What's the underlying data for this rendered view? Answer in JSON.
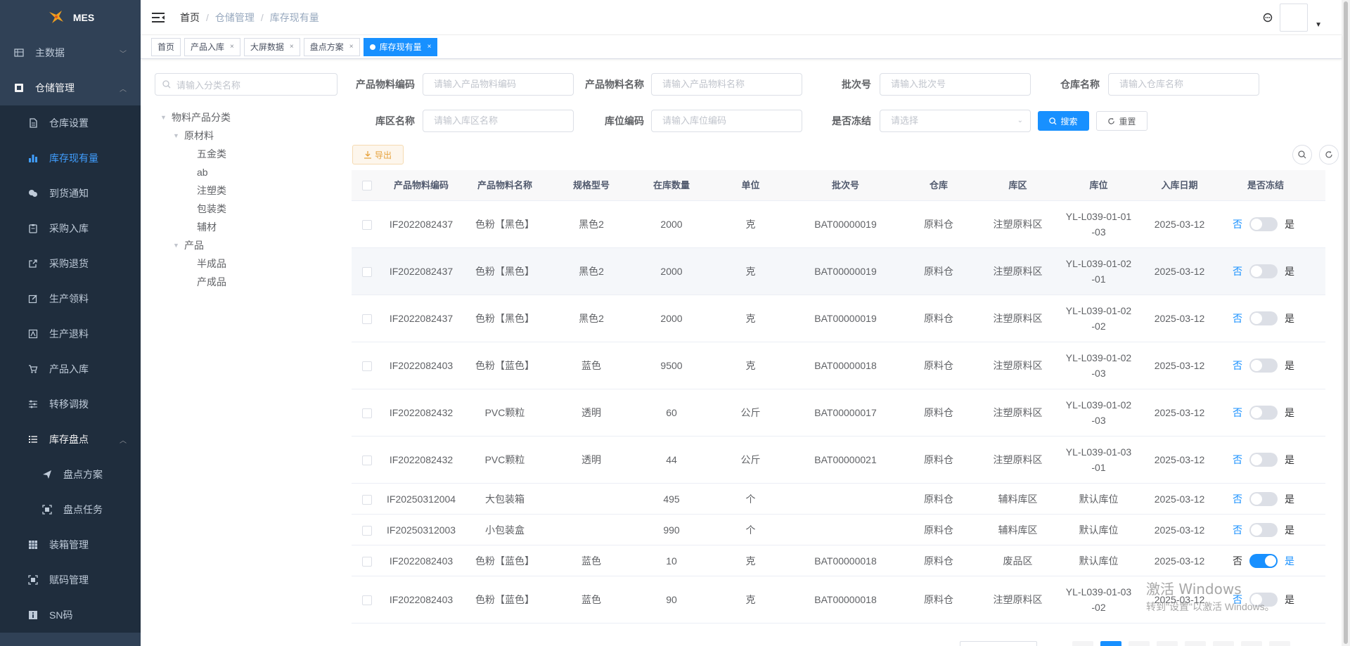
{
  "app": {
    "logo_text": "MES"
  },
  "sidebar": {
    "items": [
      {
        "label": "主数据",
        "icon": "table-icon",
        "level": 0,
        "chevron": "down"
      },
      {
        "label": "仓储管理",
        "icon": "warehouse-icon",
        "level": 0,
        "chevron": "up",
        "open": true
      },
      {
        "label": "仓库设置",
        "icon": "document-icon",
        "level": 1
      },
      {
        "label": "库存现有量",
        "icon": "bar-chart-icon",
        "level": 1,
        "active": true
      },
      {
        "label": "到货通知",
        "icon": "wechat-icon",
        "level": 1
      },
      {
        "label": "采购入库",
        "icon": "clipboard-icon",
        "level": 1
      },
      {
        "label": "采购退货",
        "icon": "external-link-icon",
        "level": 1
      },
      {
        "label": "生产领料",
        "icon": "edit-icon",
        "level": 1
      },
      {
        "label": "生产退料",
        "icon": "box-icon",
        "level": 1
      },
      {
        "label": "产品入库",
        "icon": "cart-icon",
        "level": 1
      },
      {
        "label": "转移调拨",
        "icon": "sliders-icon",
        "level": 1
      },
      {
        "label": "库存盘点",
        "icon": "list-icon",
        "level": 1,
        "chevron": "up",
        "open": true
      },
      {
        "label": "盘点方案",
        "icon": "send-icon",
        "level": 2
      },
      {
        "label": "盘点任务",
        "icon": "scan-icon",
        "level": 2
      },
      {
        "label": "装箱管理",
        "icon": "grid-icon",
        "level": 1
      },
      {
        "label": "赋码管理",
        "icon": "scan-icon",
        "level": 1
      },
      {
        "label": "SN码",
        "icon": "info-icon",
        "level": 1
      }
    ]
  },
  "navbar": {
    "breadcrumb": [
      "首页",
      "仓储管理",
      "库存现有量"
    ]
  },
  "tags": [
    {
      "label": "首页",
      "closable": false,
      "active": false
    },
    {
      "label": "产品入库",
      "closable": true,
      "active": false
    },
    {
      "label": "大屏数据",
      "closable": true,
      "active": false
    },
    {
      "label": "盘点方案",
      "closable": true,
      "active": false
    },
    {
      "label": "库存现有量",
      "closable": true,
      "active": true
    }
  ],
  "tree": {
    "search_placeholder": "请输入分类名称",
    "nodes": [
      {
        "label": "物料产品分类",
        "depth": 0,
        "arrow": true
      },
      {
        "label": "原材料",
        "depth": 1,
        "arrow": true
      },
      {
        "label": "五金类",
        "depth": 2,
        "arrow": false
      },
      {
        "label": "ab",
        "depth": 2,
        "arrow": false
      },
      {
        "label": "注塑类",
        "depth": 2,
        "arrow": false
      },
      {
        "label": "包装类",
        "depth": 2,
        "arrow": false
      },
      {
        "label": "辅材",
        "depth": 2,
        "arrow": false
      },
      {
        "label": "产品",
        "depth": 1,
        "arrow": true
      },
      {
        "label": "半成品",
        "depth": 2,
        "arrow": false
      },
      {
        "label": "产成品",
        "depth": 2,
        "arrow": false
      }
    ]
  },
  "filters": {
    "item_code": {
      "label": "产品物料编码",
      "placeholder": "请输入产品物料编码"
    },
    "item_name": {
      "label": "产品物料名称",
      "placeholder": "请输入产品物料名称"
    },
    "batch": {
      "label": "批次号",
      "placeholder": "请输入批次号"
    },
    "warehouse": {
      "label": "仓库名称",
      "placeholder": "请输入仓库名称"
    },
    "area": {
      "label": "库区名称",
      "placeholder": "请输入库区名称"
    },
    "location": {
      "label": "库位编码",
      "placeholder": "请输入库位编码"
    },
    "frozen": {
      "label": "是否冻结",
      "placeholder": "请选择"
    },
    "search_label": "搜索",
    "reset_label": "重置",
    "export_label": "导出"
  },
  "table": {
    "headers": [
      "产品物料编码",
      "产品物料名称",
      "规格型号",
      "在库数量",
      "单位",
      "批次号",
      "仓库",
      "库区",
      "库位",
      "入库日期",
      "是否冻结"
    ],
    "rows": [
      {
        "code": "IF2022082437",
        "name": "色粉【黑色】",
        "spec": "黑色2",
        "qty": "2000",
        "unit": "克",
        "batch": "BAT00000019",
        "wh": "原料仓",
        "area": "注塑原料区",
        "loc1": "YL-L039-01-01",
        "loc2": "-03",
        "date": "2025-03-12",
        "no": "否",
        "yes": "是",
        "frozen": false
      },
      {
        "code": "IF2022082437",
        "name": "色粉【黑色】",
        "spec": "黑色2",
        "qty": "2000",
        "unit": "克",
        "batch": "BAT00000019",
        "wh": "原料仓",
        "area": "注塑原料区",
        "loc1": "YL-L039-01-02",
        "loc2": "-01",
        "date": "2025-03-12",
        "no": "否",
        "yes": "是",
        "frozen": false,
        "highlight": true
      },
      {
        "code": "IF2022082437",
        "name": "色粉【黑色】",
        "spec": "黑色2",
        "qty": "2000",
        "unit": "克",
        "batch": "BAT00000019",
        "wh": "原料仓",
        "area": "注塑原料区",
        "loc1": "YL-L039-01-02",
        "loc2": "-02",
        "date": "2025-03-12",
        "no": "否",
        "yes": "是",
        "frozen": false
      },
      {
        "code": "IF2022082403",
        "name": "色粉【蓝色】",
        "spec": "蓝色",
        "qty": "9500",
        "unit": "克",
        "batch": "BAT00000018",
        "wh": "原料仓",
        "area": "注塑原料区",
        "loc1": "YL-L039-01-02",
        "loc2": "-03",
        "date": "2025-03-12",
        "no": "否",
        "yes": "是",
        "frozen": false
      },
      {
        "code": "IF2022082432",
        "name": "PVC颗粒",
        "spec": "透明",
        "qty": "60",
        "unit": "公斤",
        "batch": "BAT00000017",
        "wh": "原料仓",
        "area": "注塑原料区",
        "loc1": "YL-L039-01-02",
        "loc2": "-03",
        "date": "2025-03-12",
        "no": "否",
        "yes": "是",
        "frozen": false
      },
      {
        "code": "IF2022082432",
        "name": "PVC颗粒",
        "spec": "透明",
        "qty": "44",
        "unit": "公斤",
        "batch": "BAT00000021",
        "wh": "原料仓",
        "area": "注塑原料区",
        "loc1": "YL-L039-01-03",
        "loc2": "-01",
        "date": "2025-03-12",
        "no": "否",
        "yes": "是",
        "frozen": false
      },
      {
        "code": "IF20250312004",
        "name": "大包装箱",
        "spec": "",
        "qty": "495",
        "unit": "个",
        "batch": "",
        "wh": "原料仓",
        "area": "辅料库区",
        "loc1": "默认库位",
        "loc2": "",
        "date": "2025-03-12",
        "no": "否",
        "yes": "是",
        "frozen": false
      },
      {
        "code": "IF20250312003",
        "name": "小包装盒",
        "spec": "",
        "qty": "990",
        "unit": "个",
        "batch": "",
        "wh": "原料仓",
        "area": "辅料库区",
        "loc1": "默认库位",
        "loc2": "",
        "date": "2025-03-12",
        "no": "否",
        "yes": "是",
        "frozen": false
      },
      {
        "code": "IF2022082403",
        "name": "色粉【蓝色】",
        "spec": "蓝色",
        "qty": "10",
        "unit": "克",
        "batch": "BAT00000018",
        "wh": "原料仓",
        "area": "废品区",
        "loc1": "默认库位",
        "loc2": "",
        "date": "2025-03-12",
        "no": "否",
        "yes": "是",
        "frozen": true
      },
      {
        "code": "IF2022082403",
        "name": "色粉【蓝色】",
        "spec": "蓝色",
        "qty": "90",
        "unit": "克",
        "batch": "BAT00000018",
        "wh": "原料仓",
        "area": "注塑原料区",
        "loc1": "YL-L039-01-03",
        "loc2": "-02",
        "date": "2025-03-12",
        "no": "否",
        "yes": "是",
        "frozen": false
      }
    ]
  },
  "watermark": {
    "line1": "激活 Windows",
    "line2": "转到\"设置\"以激活 Windows。"
  },
  "colors": {
    "sidebar_bg": "#304156",
    "submenu_bg": "#1f2d3d",
    "primary": "#1890ff",
    "warning": "#e6a23c"
  }
}
